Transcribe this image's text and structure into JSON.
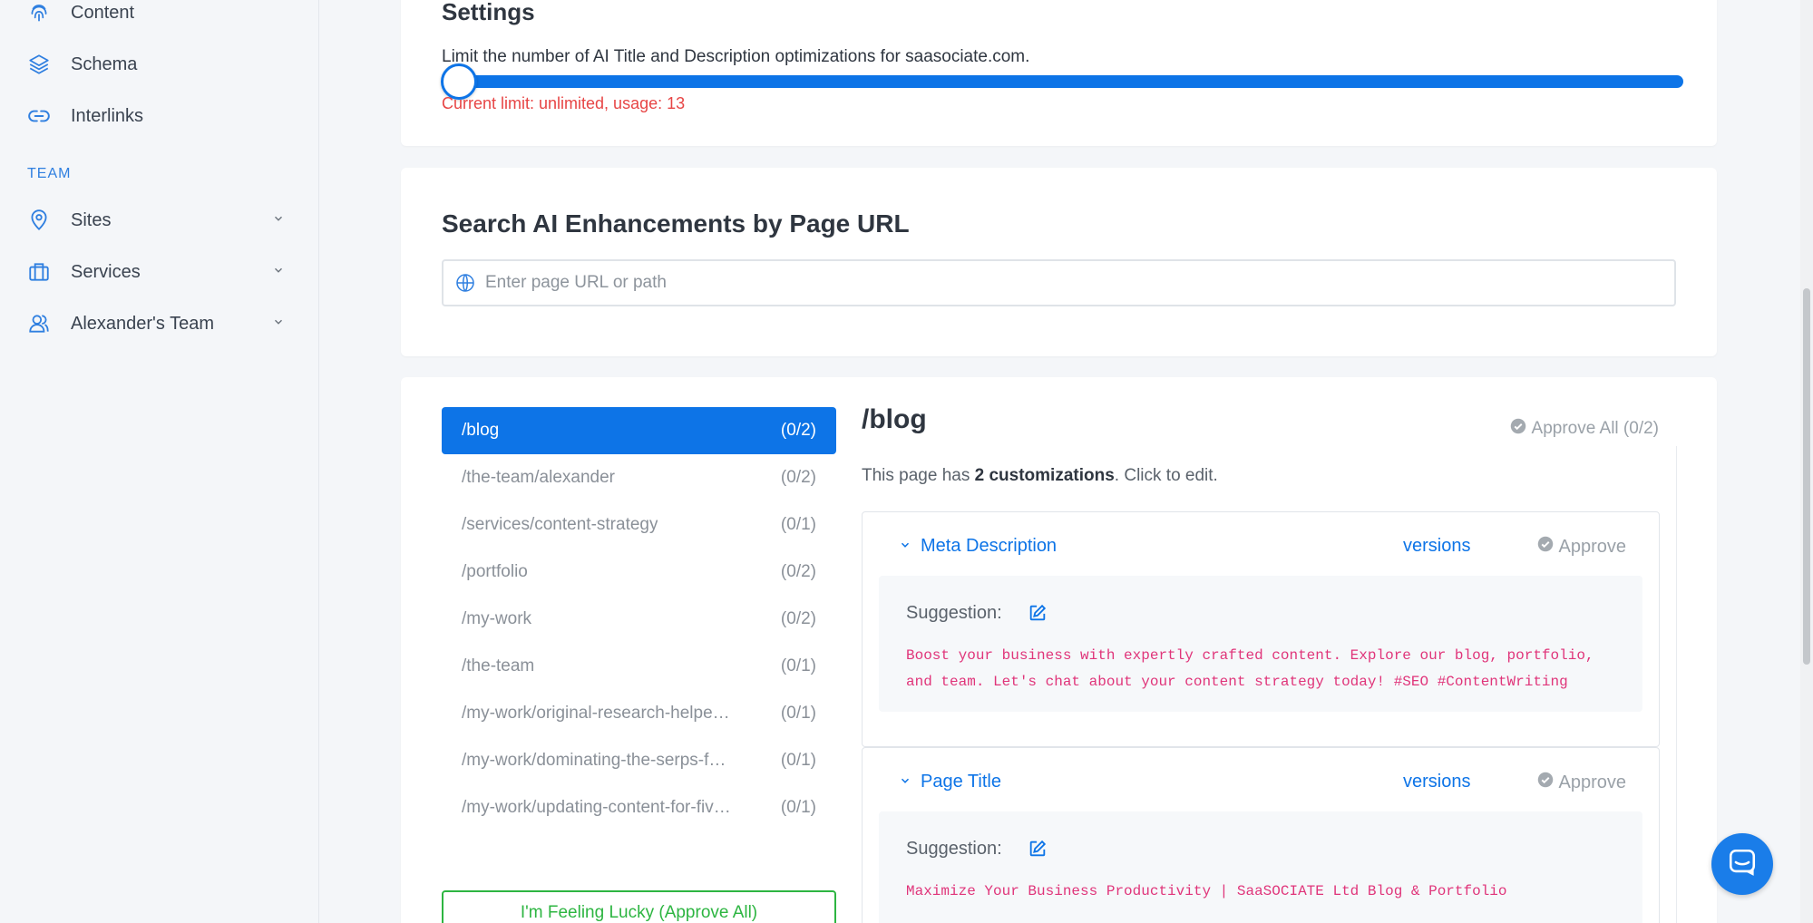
{
  "sidebar": {
    "items_top": [
      {
        "label": "Content",
        "icon": "fingerprint-icon"
      },
      {
        "label": "Schema",
        "icon": "layers-icon"
      },
      {
        "label": "Interlinks",
        "icon": "link-icon"
      }
    ],
    "team_heading": "TEAM",
    "items_team": [
      {
        "label": "Sites",
        "icon": "map-pin-icon"
      },
      {
        "label": "Services",
        "icon": "briefcase-icon"
      },
      {
        "label": "Alexander's Team",
        "icon": "users-icon"
      }
    ]
  },
  "settings": {
    "title": "Settings",
    "limit_text": "Limit the number of AI Title and Description optimizations for saasociate.com.",
    "slider_position": 0,
    "status": "Current limit: unlimited, usage: 13"
  },
  "search": {
    "title": "Search AI Enhancements by Page URL",
    "placeholder": "Enter page URL or path"
  },
  "urls": [
    {
      "path": "/blog",
      "count": "(0/2)",
      "active": true
    },
    {
      "path": "/the-team/alexander",
      "count": "(0/2)"
    },
    {
      "path": "/services/content-strategy",
      "count": "(0/1)"
    },
    {
      "path": "/portfolio",
      "count": "(0/2)"
    },
    {
      "path": "/my-work",
      "count": "(0/2)"
    },
    {
      "path": "/the-team",
      "count": "(0/1)"
    },
    {
      "path": "/my-work/original-research-helpe…",
      "count": "(0/1)"
    },
    {
      "path": "/my-work/dominating-the-serps-f…",
      "count": "(0/1)"
    },
    {
      "path": "/my-work/updating-content-for-fiv…",
      "count": "(0/1)"
    }
  ],
  "lucky_button": "I'm Feeling Lucky (Approve All)",
  "detail": {
    "title": "/blog",
    "approve_all": "Approve All (0/2)",
    "info_prefix": "This page has ",
    "info_bold": "2 customizations",
    "info_suffix": ". Click to edit.",
    "cards": [
      {
        "title": "Meta Description",
        "versions": "versions",
        "approve": "Approve",
        "suggestion_label": "Suggestion:",
        "text": "Boost your business with expertly crafted content. Explore our blog, portfolio, and team. Let's chat about your content strategy today! #SEO #ContentWriting"
      },
      {
        "title": "Page Title",
        "versions": "versions",
        "approve": "Approve",
        "suggestion_label": "Suggestion:",
        "text": "Maximize Your Business Productivity | SaaSOCIATE Ltd Blog & Portfolio"
      }
    ]
  },
  "colors": {
    "accent": "#0d74e7",
    "error": "#e74545",
    "success": "#2db541",
    "suggestion": "#e0357a"
  }
}
